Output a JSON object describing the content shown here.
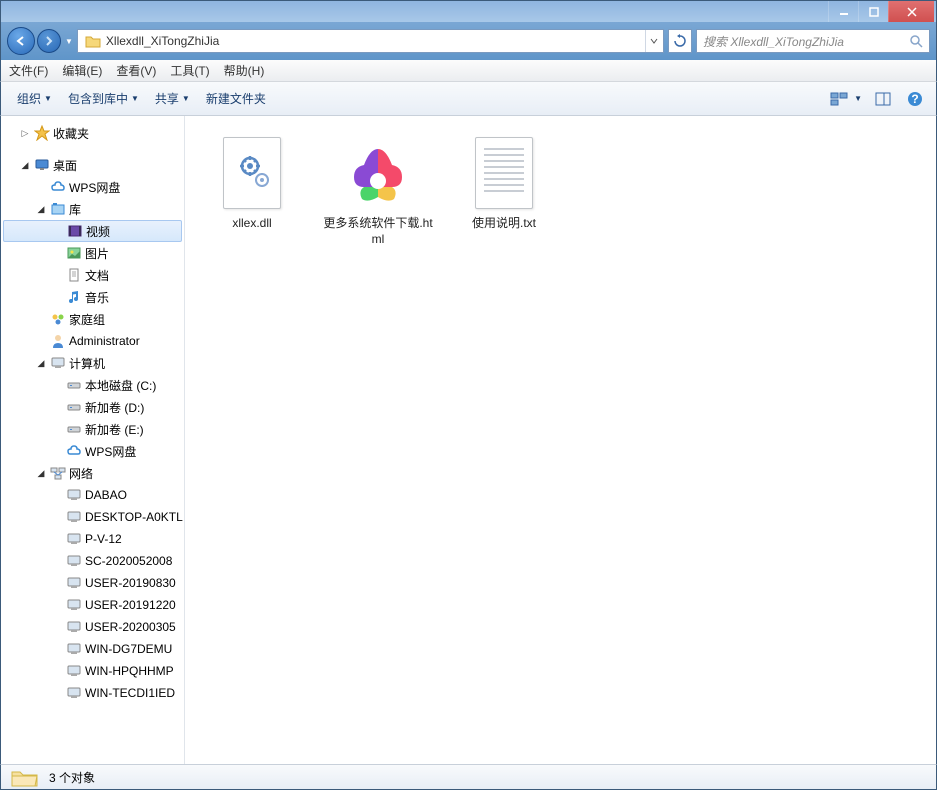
{
  "titlebar": {
    "buttons": [
      "minimize",
      "maximize",
      "close"
    ]
  },
  "nav": {
    "path": "Xllexdll_XiTongZhiJia",
    "search_placeholder": "搜索 Xllexdll_XiTongZhiJia"
  },
  "menu": {
    "file": "文件(F)",
    "edit": "编辑(E)",
    "view": "查看(V)",
    "tools": "工具(T)",
    "help": "帮助(H)"
  },
  "toolbar": {
    "organize": "组织",
    "include": "包含到库中",
    "share": "共享",
    "newfolder": "新建文件夹"
  },
  "sidebar": {
    "favorites": "收藏夹",
    "desktop": "桌面",
    "wps": "WPS网盘",
    "libraries": "库",
    "videos": "视频",
    "pictures": "图片",
    "documents": "文档",
    "music": "音乐",
    "homegroup": "家庭组",
    "admin": "Administrator",
    "computer": "计算机",
    "drive_c": "本地磁盘 (C:)",
    "drive_d": "新加卷 (D:)",
    "drive_e": "新加卷 (E:)",
    "wps2": "WPS网盘",
    "network": "网络",
    "net_items": [
      "DABAO",
      "DESKTOP-A0KTL",
      "P-V-12",
      "SC-2020052008",
      "USER-20190830",
      "USER-20191220",
      "USER-20200305",
      "WIN-DG7DEMU",
      "WIN-HPQHHMP",
      "WIN-TECDI1IED"
    ]
  },
  "files": [
    {
      "name": "xllex.dll",
      "type": "dll"
    },
    {
      "name": "更多系统软件下载.html",
      "type": "html"
    },
    {
      "name": "使用说明.txt",
      "type": "txt"
    }
  ],
  "status": {
    "text": "3 个对象"
  }
}
